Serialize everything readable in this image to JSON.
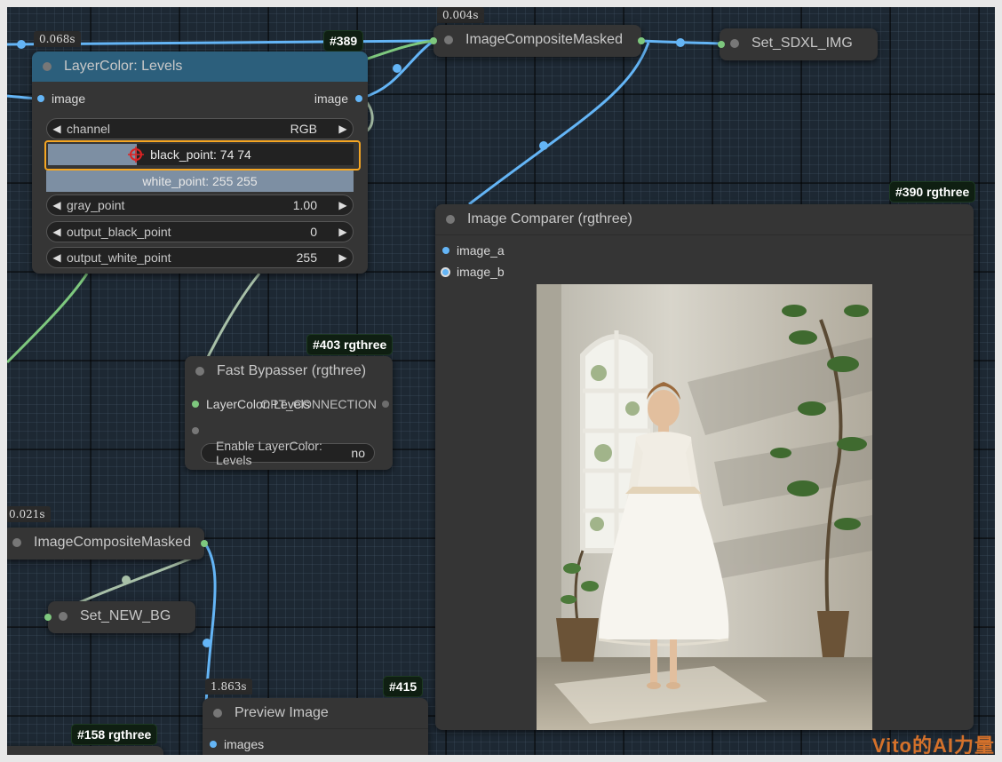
{
  "levels": {
    "timing": "0.068s",
    "title": "LayerColor: Levels",
    "input_label": "image",
    "output_label": "image",
    "channel_label": "channel",
    "channel_value": "RGB",
    "black_point": "black_point: 74  74",
    "white_point": "white_point: 255  255",
    "gray_label": "gray_point",
    "gray_value": "1.00",
    "out_black_label": "output_black_point",
    "out_black_value": "0",
    "out_white_label": "output_white_point",
    "out_white_value": "255"
  },
  "badge_389": "#389",
  "composite_top": {
    "timing": "0.004s",
    "title": "ImageCompositeMasked"
  },
  "set_sdxl": {
    "title": "Set_SDXL_IMG"
  },
  "comparer": {
    "badge": "#390 rgthree",
    "title": "Image Comparer (rgthree)",
    "input_a": "image_a",
    "input_b": "image_b"
  },
  "bypasser": {
    "badge": "#403 rgthree",
    "title": "Fast Bypasser (rgthree)",
    "input_label": "LayerColor: Levels",
    "output_label": "OPT_CONNECTION",
    "toggle_label": "Enable LayerColor: Levels",
    "toggle_value": "no"
  },
  "composite_left": {
    "timing": "0.021s",
    "title": "ImageCompositeMasked"
  },
  "set_new_bg": {
    "title": "Set_NEW_BG"
  },
  "preview": {
    "timing": "1.863s",
    "badge": "#415",
    "title": "Preview Image",
    "input_label": "images"
  },
  "badge_158": "#158 rgthree",
  "watermark": "Vito的AI力量",
  "colors": {
    "image_wire": "#64b5f6",
    "mask_wire": "#7ec87e",
    "highlight": "#f5a623",
    "badge_bg": "#0f1f12"
  }
}
